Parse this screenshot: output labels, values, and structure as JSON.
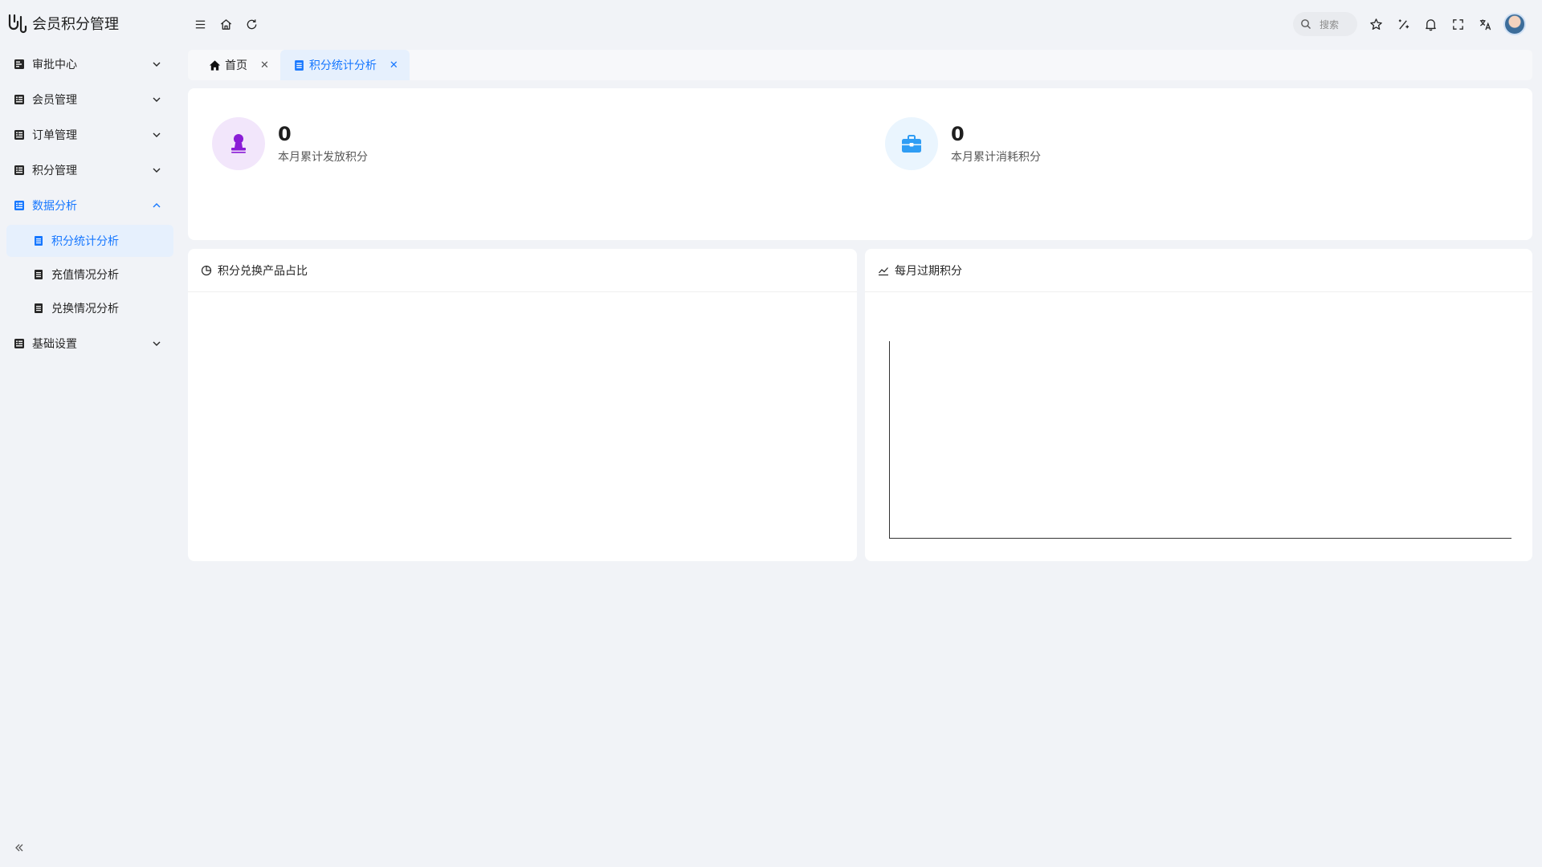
{
  "app": {
    "title": "会员积分管理",
    "logo_icon": "app-logo-icon"
  },
  "sidebar": {
    "items": [
      {
        "label": "审批中心",
        "icon": "approval-icon",
        "expanded": false
      },
      {
        "label": "会员管理",
        "icon": "member-icon",
        "expanded": false
      },
      {
        "label": "订单管理",
        "icon": "order-icon",
        "expanded": false
      },
      {
        "label": "积分管理",
        "icon": "points-icon",
        "expanded": false
      },
      {
        "label": "数据分析",
        "icon": "analytics-icon",
        "expanded": true,
        "children": [
          {
            "label": "积分统计分析",
            "selected": true
          },
          {
            "label": "充值情况分析",
            "selected": false
          },
          {
            "label": "兑换情况分析",
            "selected": false
          }
        ]
      },
      {
        "label": "基础设置",
        "icon": "settings-icon",
        "expanded": false
      }
    ]
  },
  "header": {
    "search_placeholder": "搜索"
  },
  "tabs": [
    {
      "label": "首页",
      "icon": "home-icon",
      "active": false
    },
    {
      "label": "积分统计分析",
      "icon": "document-icon",
      "active": true
    }
  ],
  "stats": [
    {
      "value": "0",
      "label": "本月累计发放积分",
      "icon": "stamp-icon",
      "bubble_color": "#f2e6fb",
      "icon_color": "#8a1dd6"
    },
    {
      "value": "0",
      "label": "本月累计消耗积分",
      "icon": "toolbox-icon",
      "bubble_color": "#eaf5fe",
      "icon_color": "#2f9df4"
    }
  ],
  "panels": {
    "pie_title": "积分兑换产品占比",
    "line_title": "每月过期积分"
  },
  "colors": {
    "accent": "#1677ff",
    "background": "#f1f3f7"
  },
  "chart_data": [
    {
      "type": "pie",
      "title": "积分兑换产品占比",
      "categories": [],
      "values": []
    },
    {
      "type": "line",
      "title": "每月过期积分",
      "x": [],
      "series": []
    }
  ]
}
